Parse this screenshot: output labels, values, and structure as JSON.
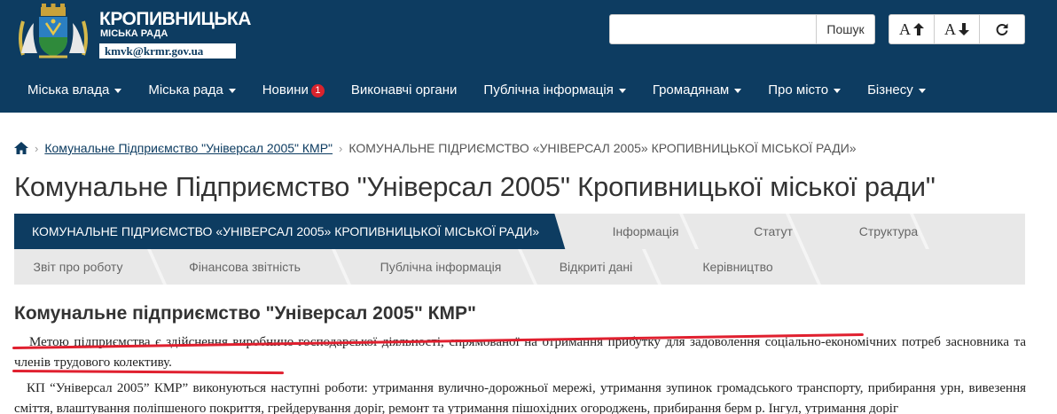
{
  "header": {
    "city_name": "КРОПИВНИЦЬКА",
    "council": "МІСЬКА РАДА",
    "email": "kmvk@krmr.gov.ua",
    "search_placeholder": "",
    "search_button": "Пошук",
    "tools": [
      {
        "label": "A",
        "icon": "arrow-up-icon"
      },
      {
        "label": "A",
        "icon": "arrow-down-icon"
      },
      {
        "label": "",
        "icon": "refresh-icon"
      }
    ]
  },
  "nav": {
    "items": [
      {
        "label": "Міська влада",
        "dropdown": true
      },
      {
        "label": "Міська рада",
        "dropdown": true
      },
      {
        "label": "Новини",
        "dropdown": false,
        "badge": "1"
      },
      {
        "label": "Виконавчі органи",
        "dropdown": false
      },
      {
        "label": "Публічна інформація",
        "dropdown": true
      },
      {
        "label": "Громадянам",
        "dropdown": true
      },
      {
        "label": "Про місто",
        "dropdown": true
      },
      {
        "label": "Бізнесу",
        "dropdown": true
      }
    ]
  },
  "breadcrumb": {
    "home_icon": "home-icon",
    "link": "Комунальне Підприємство \"Універсал 2005\" КМР\"",
    "current": "КОМУНАЛЬНЕ ПІДРИЄМСТВО «УНІВЕРСАЛ 2005» КРОПИВНИЦЬКОЇ МІСЬКОЇ РАДИ»"
  },
  "page_title": "Комунальне Підприємство \"Універсал 2005\" Кропивницької міської ради\"",
  "tabs": {
    "row1": [
      {
        "label": "КОМУНАЛЬНЕ ПІДРИЄМСТВО «УНІВЕРСАЛ 2005» КРОПИВНИЦЬКОЇ МІСЬКОЇ РАДИ»",
        "active": true
      },
      {
        "label": "Інформація",
        "active": false
      },
      {
        "label": "Статут",
        "active": false
      },
      {
        "label": "Структура",
        "active": false
      }
    ],
    "row2": [
      {
        "label": "Звіт про роботу",
        "active": false
      },
      {
        "label": "Фінансова звітність",
        "active": false
      },
      {
        "label": "Публічна інформація",
        "active": false
      },
      {
        "label": "Відкриті дані",
        "active": false
      },
      {
        "label": "Керівництво",
        "active": false
      }
    ]
  },
  "content": {
    "title": "Комунальне підприємство \"Універсал 2005\" КМР\"",
    "paragraph1": "Метою підприємства є здійснення виробничо-господарської діяльності, спрямованої на отримання прибутку для задоволення соціально-економічних потреб засновника та членів трудового колективу.",
    "paragraph2": "КП “Універсал 2005” КМР” виконуються наступні роботи: утримання вулично-дорожньої мережі,  утримання зупинок громадського транспорту, прибирання урн, вивезення сміття, влаштування поліпшеного покриття, грейдерування доріг, ремонт та утримання пішохідних огороджень, прибирання берм р. Інгул, утримання доріг"
  },
  "colors": {
    "header_bg": "#0d3c61",
    "tab_active_bg": "#0d3c61",
    "tab_bg": "#e8e8e8",
    "badge": "#d9232d",
    "annotation_red": "#e0202f"
  }
}
